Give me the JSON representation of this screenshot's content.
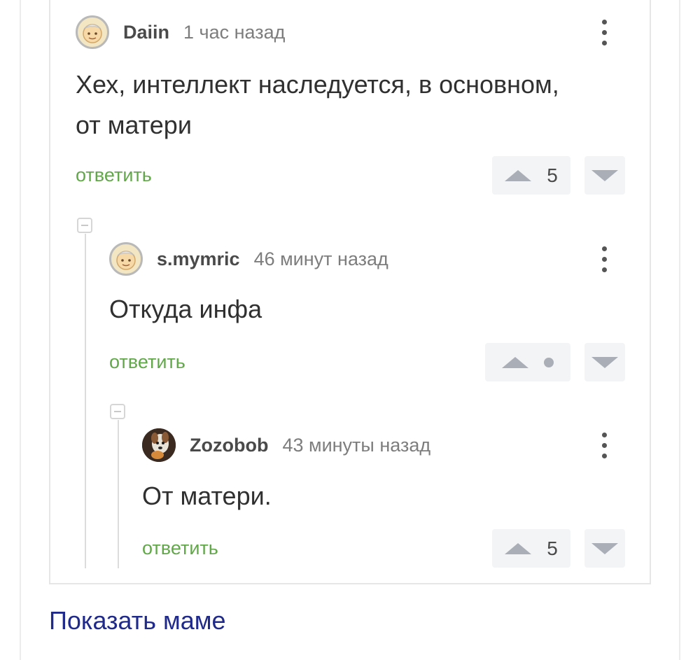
{
  "comments": [
    {
      "username": "Daiin",
      "time": "1 час назад",
      "text_line1": "Хех, интеллект наследуется, в основном,",
      "text_line2": "от матери",
      "reply": "ответить",
      "rating": "5"
    },
    {
      "username": "s.mymric",
      "time": "46 минут назад",
      "text_line1": "Откуда инфа",
      "reply": "ответить",
      "rating": ""
    },
    {
      "username": "Zozobob",
      "time": "43 минуты назад",
      "text_line1": "От матери.",
      "reply": "ответить",
      "rating": "5"
    }
  ],
  "footer": {
    "share_link": "Показать маме"
  },
  "colors": {
    "reply_link": "#62a84a",
    "share_link": "#1f2a8a",
    "vote_bg": "#f3f4f6",
    "vote_arrow": "#a9aeb7"
  },
  "icons": [
    "default-avatar-icon",
    "photo-avatar-icon",
    "more-vertical-icon",
    "upvote-icon",
    "downvote-icon",
    "collapse-icon"
  ]
}
